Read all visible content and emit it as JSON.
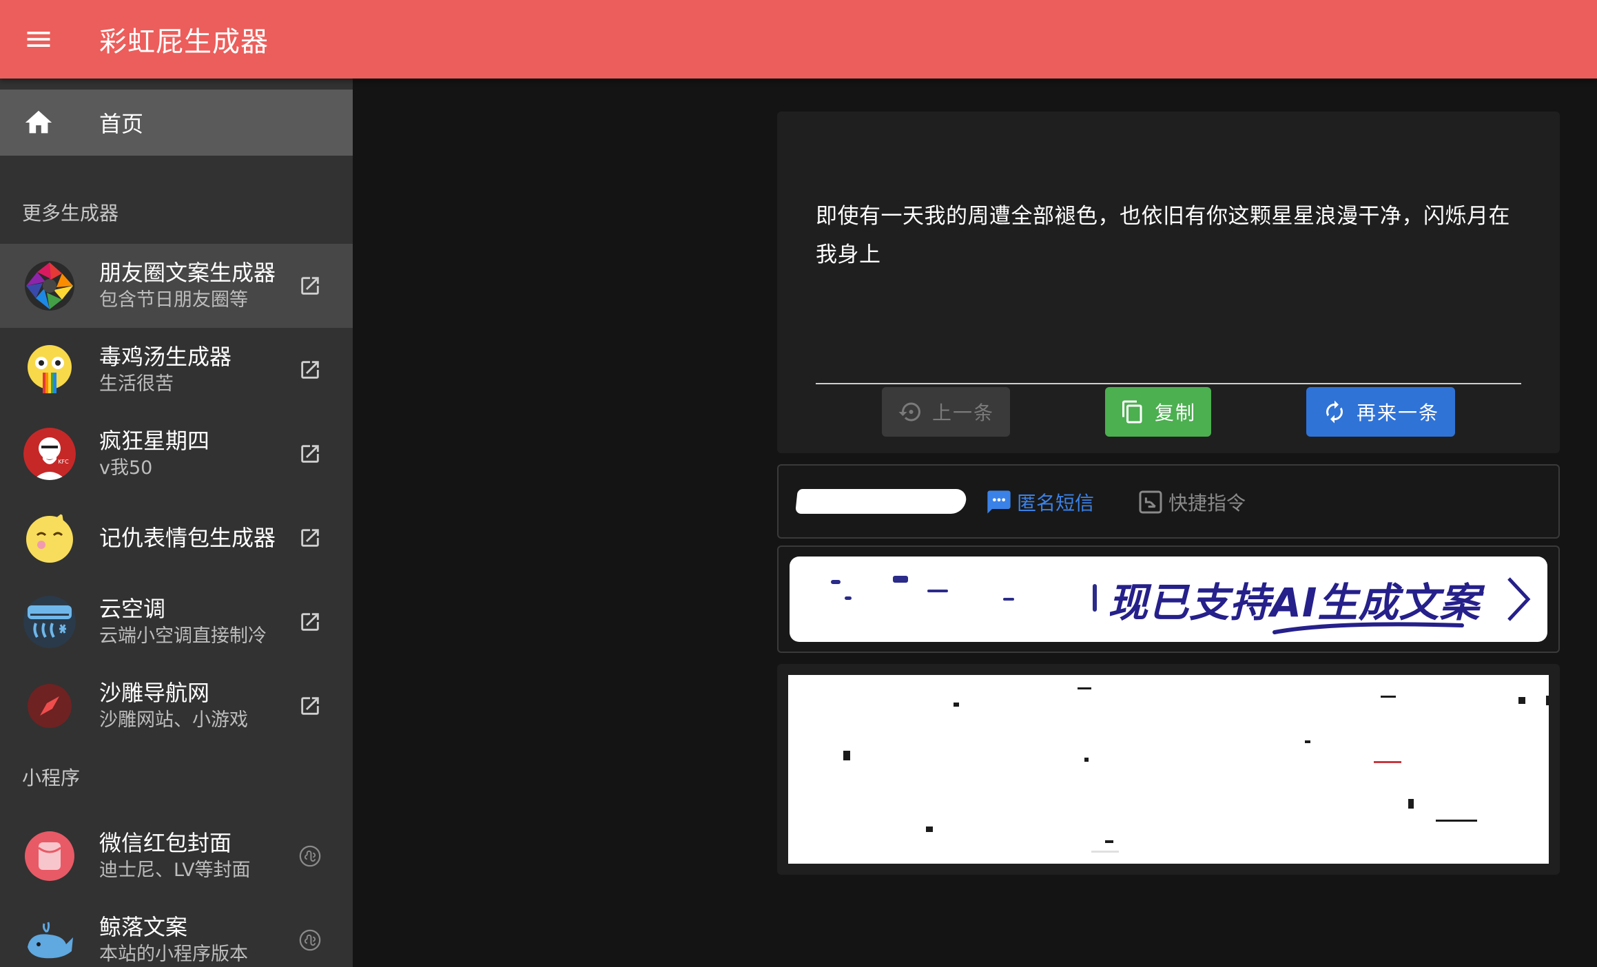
{
  "app": {
    "title": "彩虹屁生成器",
    "accent_color": "#ec5e5b"
  },
  "sidebar": {
    "home": {
      "label": "首页",
      "icon": "home-icon"
    },
    "section_more": "更多生成器",
    "generators": [
      {
        "title": "朋友圈文案生成器",
        "subtitle": "包含节日朋友圈等",
        "icon": "aperture-icon",
        "trailing_icon": "open-in-new-icon"
      },
      {
        "title": "毒鸡汤生成器",
        "subtitle": "生活很苦",
        "icon": "rainbow-face-icon",
        "trailing_icon": "open-in-new-icon"
      },
      {
        "title": "疯狂星期四",
        "subtitle": "v我50",
        "icon": "kfc-logo-icon",
        "trailing_icon": "open-in-new-icon"
      },
      {
        "title": "记仇表情包生成器",
        "subtitle": "",
        "icon": "grudge-face-icon",
        "trailing_icon": "open-in-new-icon"
      },
      {
        "title": "云空调",
        "subtitle": "云端小空调直接制冷",
        "icon": "air-conditioner-icon",
        "trailing_icon": "open-in-new-icon"
      },
      {
        "title": "沙雕导航网",
        "subtitle": "沙雕网站、小游戏",
        "icon": "compass-icon",
        "trailing_icon": "open-in-new-icon"
      }
    ],
    "section_mini": "小程序",
    "mini_programs": [
      {
        "title": "微信红包封面",
        "subtitle": "迪士尼、LV等封面",
        "icon": "red-envelope-icon",
        "trailing_icon": "mini-program-icon"
      },
      {
        "title": "鲸落文案",
        "subtitle": "本站的小程序版本",
        "icon": "whale-icon",
        "trailing_icon": "mini-program-icon"
      }
    ]
  },
  "main": {
    "quote": "即使有一天我的周遭全部褪色，也依旧有你这颗星星浪漫干净，闪烁月在我身上",
    "buttons": {
      "prev": "上一条",
      "copy": "复制",
      "more": "再来一条"
    },
    "links": {
      "sms": "匿名短信",
      "shortcut": "快捷指令"
    },
    "banner": {
      "text": "现已支持AI生成文案"
    },
    "colors": {
      "copy_button": "#4caf50",
      "more_button": "#2f73d7",
      "link_blue": "#3b82e8",
      "banner_text": "#25208a"
    }
  }
}
